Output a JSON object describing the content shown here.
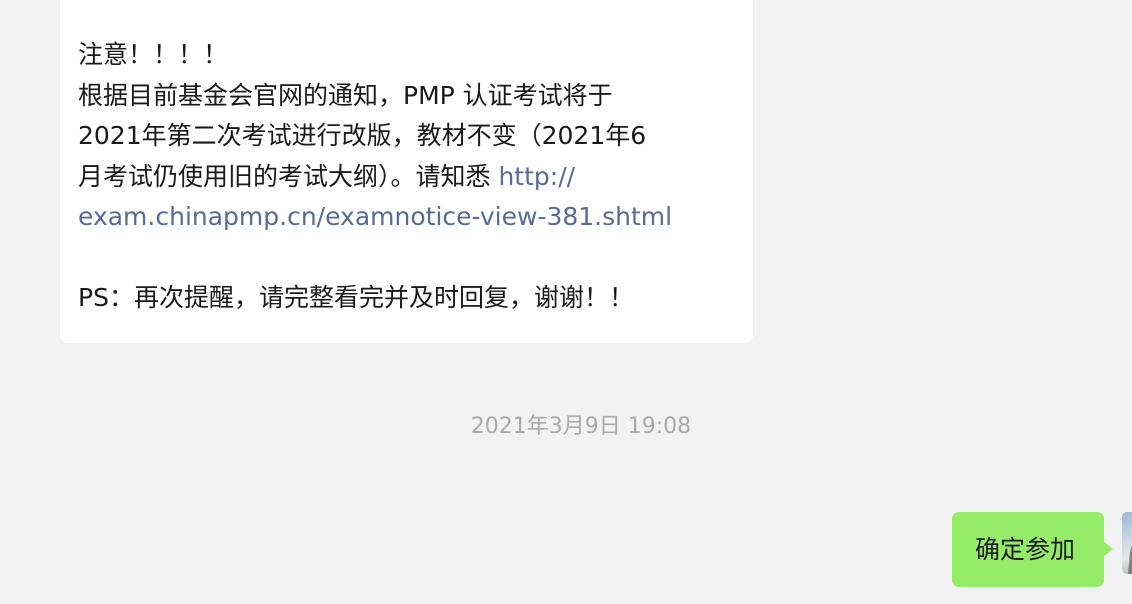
{
  "incoming_message": {
    "line_1": "注意！！！！",
    "line_2": "根据目前基金会官网的通知，PMP 认证考试将于",
    "line_3": "2021年第二次考试进行改版，教材不变（2021年6",
    "line_4_text": "月考试仍使用旧的考试大纲）。请知悉 ",
    "link_part_1": "http://",
    "link_part_2": "exam.chinapmp.cn/examnotice-view-381.shtml",
    "ps_line": "PS：再次提醒，请完整看完并及时回复，谢谢！！"
  },
  "timestamp": "2021年3月9日 19:08",
  "outgoing_message": {
    "text": "确定参加"
  },
  "colors": {
    "background": "#f2f2f2",
    "incoming_bubble": "#ffffff",
    "outgoing_bubble": "#95ec69",
    "link": "#576b95",
    "timestamp": "#aaaaaa"
  }
}
